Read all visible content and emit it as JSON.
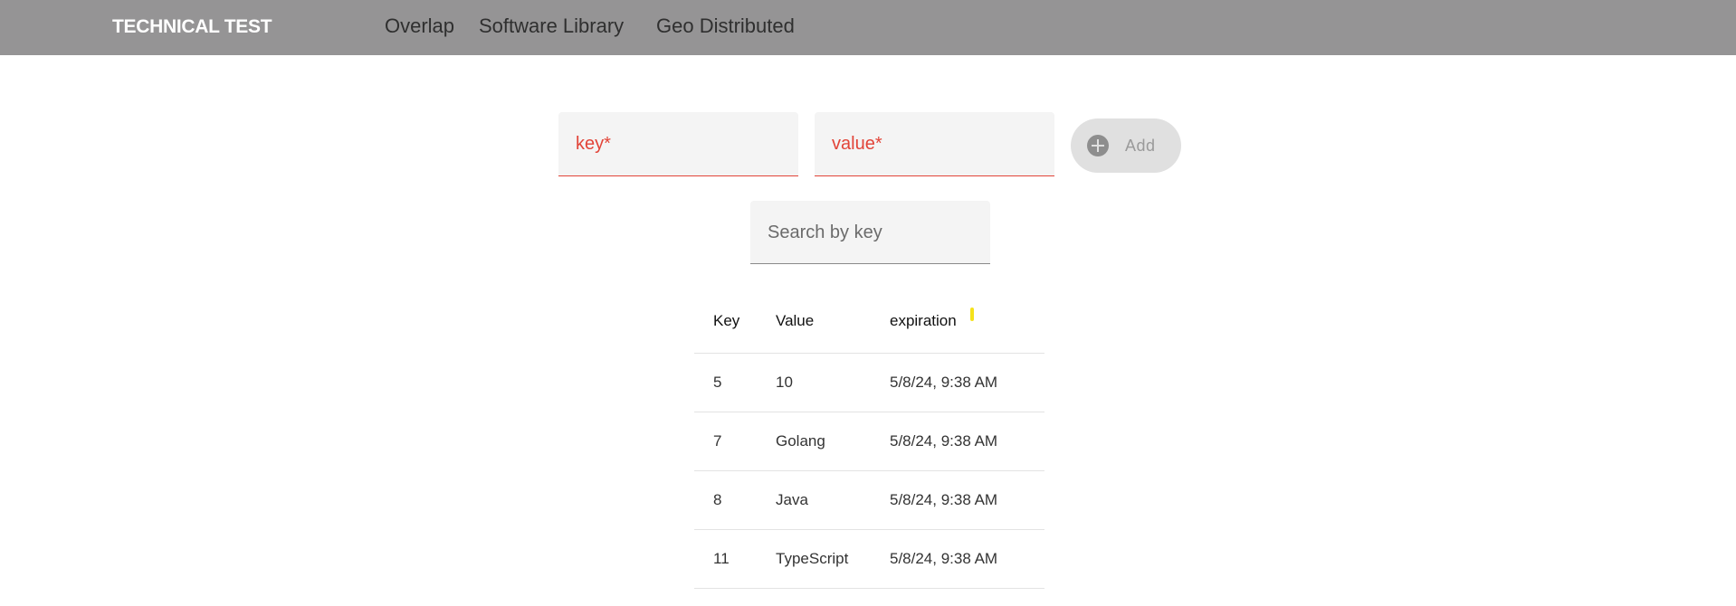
{
  "header": {
    "brand": "TECHNICAL TEST",
    "nav": [
      "Overlap",
      "Software Library",
      "Geo Distributed"
    ]
  },
  "form": {
    "key_label": "key*",
    "value_label": "value*",
    "add_label": "Add",
    "error_color": "#e24438"
  },
  "search": {
    "placeholder": "Search by key"
  },
  "table": {
    "columns": [
      "Key",
      "Value",
      "expiration"
    ],
    "rows": [
      {
        "key": "5",
        "value": "10",
        "expiration": "5/8/24, 9:38 AM"
      },
      {
        "key": "7",
        "value": "Golang",
        "expiration": "5/8/24, 9:38 AM"
      },
      {
        "key": "8",
        "value": "Java",
        "expiration": "5/8/24, 9:38 AM"
      },
      {
        "key": "11",
        "value": "TypeScript",
        "expiration": "5/8/24, 9:38 AM"
      }
    ]
  }
}
